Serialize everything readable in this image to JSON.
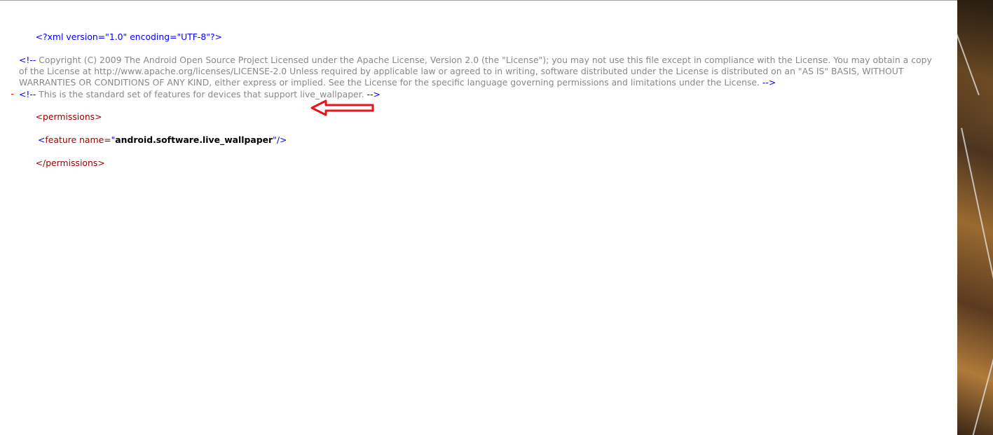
{
  "xml": {
    "declaration": "<?xml version=\"1.0\" encoding=\"UTF-8\"?>",
    "comment1": {
      "open": "<!--",
      "text": "Copyright (C) 2009 The Android Open Source Project Licensed under the Apache License, Version 2.0 (the \"License\"); you may not use this file except in compliance with the License. You may obtain a copy of the License at http://www.apache.org/licenses/LICENSE-2.0 Unless required by applicable law or agreed to in writing, software distributed under the License is distributed on an \"AS IS\" BASIS, WITHOUT WARRANTIES OR CONDITIONS OF ANY KIND, either express or implied. See the License for the specific language governing permissions and limitations under the License.",
      "close": "-->"
    },
    "comment2": {
      "open": "<!--",
      "text": "This is the standard set of features for devices that support live_wallpaper.",
      "close": "-->"
    },
    "collapse_toggle": "-",
    "permissions_open": "<permissions>",
    "feature": {
      "open": "<",
      "tag_and_attr": "feature name=",
      "quote": "\"",
      "value": "android.software.live_wallpaper",
      "close": "/>"
    },
    "permissions_close": "</permissions>"
  },
  "colors": {
    "tag": "#990000",
    "delimiter": "#0000ff",
    "comment_text": "#888888",
    "toggle": "#ff0000",
    "annotation_arrow": "#e8141c"
  },
  "annotation": {
    "icon": "red-left-arrow-icon"
  }
}
